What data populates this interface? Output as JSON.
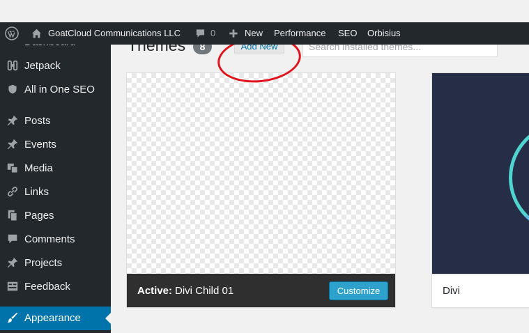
{
  "admin_bar": {
    "site_name": "GoatCloud Communications LLC",
    "comments_count": "0",
    "new_label": "New",
    "performance_label": "Performance",
    "seo_label": "SEO",
    "user_label": "Orbisius"
  },
  "sidebar": {
    "items": [
      {
        "label": "Dashboard",
        "icon": "dashboard-icon"
      },
      {
        "label": "Jetpack",
        "icon": "jetpack-icon"
      },
      {
        "label": "All in One SEO",
        "icon": "shield-icon"
      },
      {
        "label": "Posts",
        "icon": "pin-icon"
      },
      {
        "label": "Events",
        "icon": "pin-icon"
      },
      {
        "label": "Media",
        "icon": "media-icon"
      },
      {
        "label": "Links",
        "icon": "link-icon"
      },
      {
        "label": "Pages",
        "icon": "pages-icon"
      },
      {
        "label": "Comments",
        "icon": "comment-icon"
      },
      {
        "label": "Projects",
        "icon": "pin-icon"
      },
      {
        "label": "Feedback",
        "icon": "feedback-icon"
      },
      {
        "label": "Appearance",
        "icon": "brush-icon",
        "current": true
      }
    ]
  },
  "main": {
    "title": "Themes",
    "count": "8",
    "add_new_label": "Add New",
    "search_placeholder": "Search installed themes...",
    "themes": [
      {
        "active_label": "Active:",
        "name": "Divi Child 01",
        "action_label": "Customize"
      },
      {
        "name": "Divi"
      }
    ]
  },
  "colors": {
    "admin_bar": "#23282d",
    "accent": "#0073aa",
    "customize_button": "#2ea2cc",
    "annotation": "#e0141c"
  }
}
